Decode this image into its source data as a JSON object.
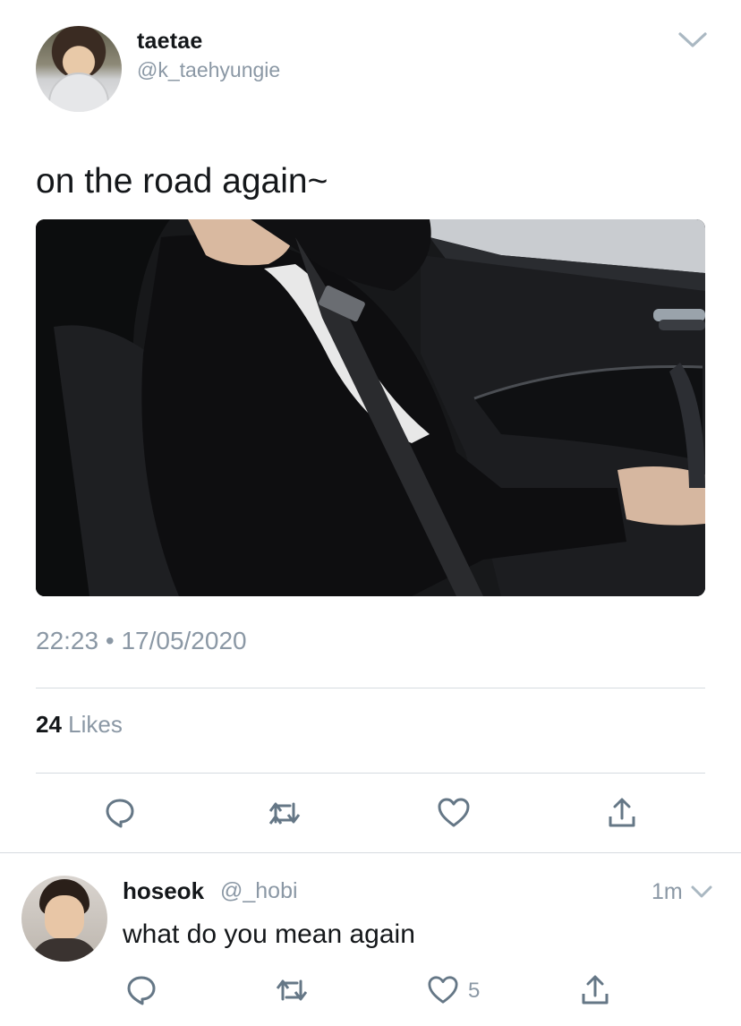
{
  "tweet": {
    "display_name": "taetae",
    "handle": "@k_taehyungie",
    "text": "on the road again~",
    "time": "22:23",
    "separator": "•",
    "date": "17/05/2020",
    "likes_count": "24",
    "likes_label": "Likes",
    "media": {
      "description_icon": "photo"
    }
  },
  "actions": {
    "reply_icon": "reply-icon",
    "retweet_icon": "retweet-icon",
    "like_icon": "heart-icon",
    "share_icon": "share-icon"
  },
  "reply": {
    "display_name": "hoseok",
    "handle": "@_hobi",
    "time": "1m",
    "text": "what do you mean again",
    "like_count": "5"
  },
  "colors": {
    "primary_text": "#14171a",
    "secondary_text": "#8b98a5",
    "divider": "#d6dbe0",
    "icon": "#657786"
  }
}
